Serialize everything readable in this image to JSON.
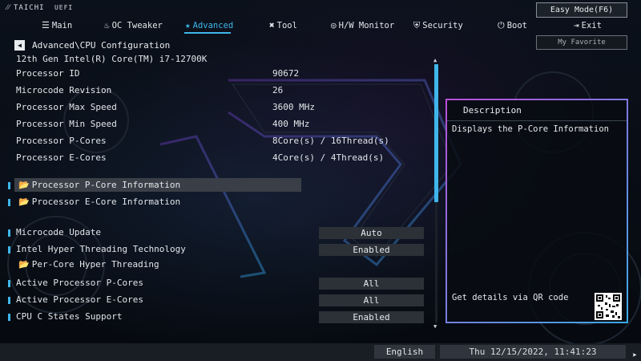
{
  "brand": {
    "name": "TAICHI",
    "suffix": "UEFI"
  },
  "top": {
    "easy_mode": "Easy Mode(F6)",
    "my_favorite": "My Favorite"
  },
  "nav": [
    {
      "label": "Main",
      "icon": "grid-icon",
      "glyph": "☰"
    },
    {
      "label": "OC Tweaker",
      "icon": "flame-icon",
      "glyph": "♨"
    },
    {
      "label": "Advanced",
      "icon": "star-icon",
      "glyph": "★"
    },
    {
      "label": "Tool",
      "icon": "tools-icon",
      "glyph": "✖"
    },
    {
      "label": "H/W Monitor",
      "icon": "monitor-icon",
      "glyph": "◎"
    },
    {
      "label": "Security",
      "icon": "shield-icon",
      "glyph": "⛨"
    },
    {
      "label": "Boot",
      "icon": "power-icon",
      "glyph": "⏻"
    },
    {
      "label": "Exit",
      "icon": "exit-icon",
      "glyph": "⇥"
    }
  ],
  "breadcrumb": "Advanced\\CPU Configuration",
  "cpu_name": "12th Gen Intel(R) Core(TM) i7-12700K",
  "info": [
    {
      "label": "Processor ID",
      "value": "90672"
    },
    {
      "label": "Microcode Revision",
      "value": "26"
    },
    {
      "label": "Processor Max Speed",
      "value": "3600 MHz"
    },
    {
      "label": "Processor Min Speed",
      "value": "400 MHz"
    },
    {
      "label": "Processor P-Cores",
      "value": "8Core(s) / 16Thread(s)"
    },
    {
      "label": "Processor E-Cores",
      "value": "4Core(s) / 4Thread(s)"
    }
  ],
  "submenus": [
    {
      "label": "Processor P-Core Information"
    },
    {
      "label": "Processor E-Core Information"
    }
  ],
  "settings": [
    {
      "label": "Microcode Update",
      "value": "Auto"
    },
    {
      "label": "Intel Hyper Threading Technology",
      "value": "Enabled"
    },
    {
      "label": "Per-Core Hyper Threading",
      "value": ""
    },
    {
      "label": "Active Processor P-Cores",
      "value": "All"
    },
    {
      "label": "Active Processor E-Cores",
      "value": "All"
    },
    {
      "label": "CPU C States Support",
      "value": "Enabled"
    }
  ],
  "description": {
    "title": "Description",
    "text": "Displays the P-Core Information",
    "qr_text": "Get details via QR code"
  },
  "bottom": {
    "language": "English",
    "datetime": "Thu 12/15/2022, 11:41:23"
  },
  "colors": {
    "accent": "#3fb6ea",
    "selected": "#3a3f47",
    "frame_gradient_start": "#b84fd6"
  }
}
